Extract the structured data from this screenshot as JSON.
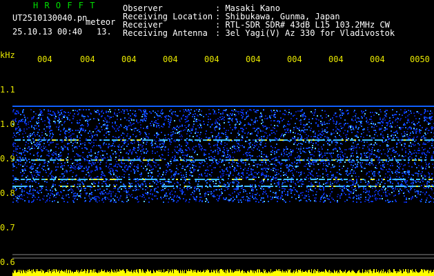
{
  "header": {
    "program": "H R O F F T",
    "filename": "UT2510130040.pn",
    "detection_type": "meteor",
    "datetime": "25.10.13 00:40",
    "count": "13.",
    "observer_label": "Observer",
    "observer_value": ": Masaki Kano",
    "location_label": "Receiving Location",
    "location_value": ": Shibukawa, Gunma, Japan",
    "receiver_label": "Receiver",
    "receiver_value": ": RTL-SDR SDR# 43dB L15 103.2MHz CW",
    "antenna_label": "Receiving Antenna",
    "antenna_value": ": 3el Yagi(V) Az 330 for Vladivostok"
  },
  "axes": {
    "y_unit": "kHz",
    "y_ticks": [
      "1.1",
      "1.0",
      "0.9",
      "0.8",
      "0.7",
      "0.6"
    ],
    "x_ticks": [
      "004",
      "004",
      "004",
      "004",
      "004",
      "004",
      "004",
      "004",
      "004",
      "0050"
    ]
  },
  "colors": {
    "background": "#000000",
    "text": "#ffffff",
    "title": "#00e000",
    "axis": "#e8e800",
    "noise": "#0020ff",
    "trace": "#ffff00"
  }
}
